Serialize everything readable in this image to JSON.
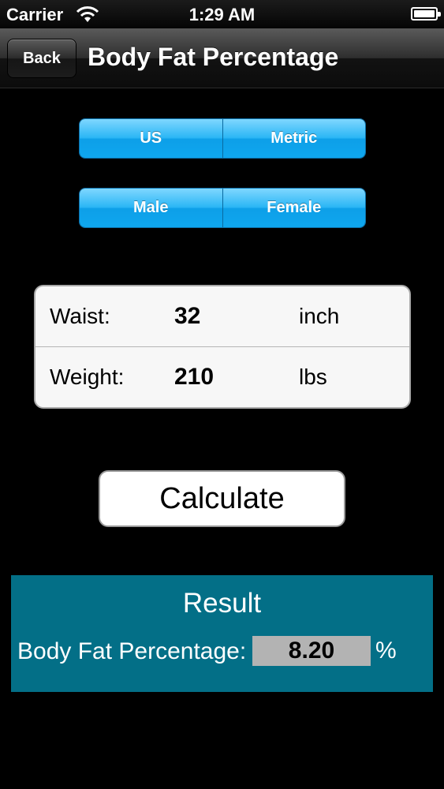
{
  "status_bar": {
    "carrier": "Carrier",
    "time": "1:29 AM",
    "wifi_icon": "wifi-icon",
    "battery_icon": "battery-icon"
  },
  "nav": {
    "back_label": "Back",
    "title": "Body Fat Percentage"
  },
  "units_selector": {
    "options": [
      "US",
      "Metric"
    ]
  },
  "gender_selector": {
    "options": [
      "Male",
      "Female"
    ]
  },
  "inputs": {
    "waist": {
      "label": "Waist:",
      "value": "32",
      "unit": "inch"
    },
    "weight": {
      "label": "Weight:",
      "value": "210",
      "unit": "lbs"
    }
  },
  "calculate_label": "Calculate",
  "result": {
    "title": "Result",
    "label": "Body Fat Percentage:",
    "value": "8.20",
    "unit": "%"
  },
  "colors": {
    "segment_accent": "#1aa9ef",
    "result_panel": "#036f87",
    "result_value_bg": "#b3b3b3"
  }
}
